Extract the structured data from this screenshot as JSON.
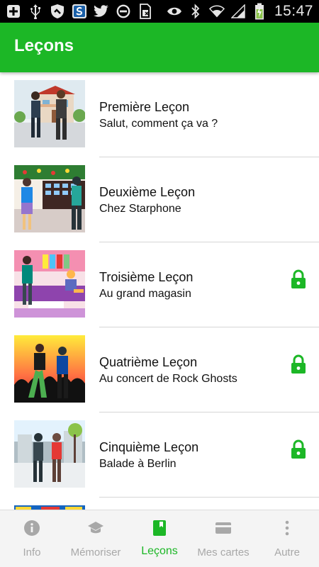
{
  "status_bar": {
    "time": "15:47",
    "left_icons": [
      "plus-icon",
      "usb-icon",
      "shield-icon",
      "app-icon",
      "twitter-icon",
      "block-icon",
      "sim-icon"
    ],
    "right_icons": [
      "eye-icon",
      "bluetooth-icon",
      "wifi-icon",
      "signal-icon",
      "battery-charging-icon"
    ]
  },
  "app_bar": {
    "title": "Leçons"
  },
  "lessons": [
    {
      "title": "Première Leçon",
      "subtitle": "Salut, comment ça va ?",
      "locked": false
    },
    {
      "title": "Deuxième Leçon",
      "subtitle": "Chez Starphone",
      "locked": false
    },
    {
      "title": "Troisième Leçon",
      "subtitle": "Au grand magasin",
      "locked": true
    },
    {
      "title": "Quatrième Leçon",
      "subtitle": "Au concert de Rock Ghosts",
      "locked": true
    },
    {
      "title": "Cinquième Leçon",
      "subtitle": "Balade à Berlin",
      "locked": true
    }
  ],
  "bottom_nav": {
    "items": [
      {
        "label": "Info",
        "icon": "info-icon",
        "active": false
      },
      {
        "label": "Mémoriser",
        "icon": "graduation-cap-icon",
        "active": false
      },
      {
        "label": "Leçons",
        "icon": "book-icon",
        "active": true
      },
      {
        "label": "Mes cartes",
        "icon": "card-icon",
        "active": false
      },
      {
        "label": "Autre",
        "icon": "more-vertical-icon",
        "active": false
      }
    ]
  },
  "colors": {
    "accent": "#1cb726",
    "app_bar": "#1cb726",
    "status_bar": "#000000",
    "nav_inactive": "#a8a8a8",
    "divider": "#d6d6d6"
  }
}
